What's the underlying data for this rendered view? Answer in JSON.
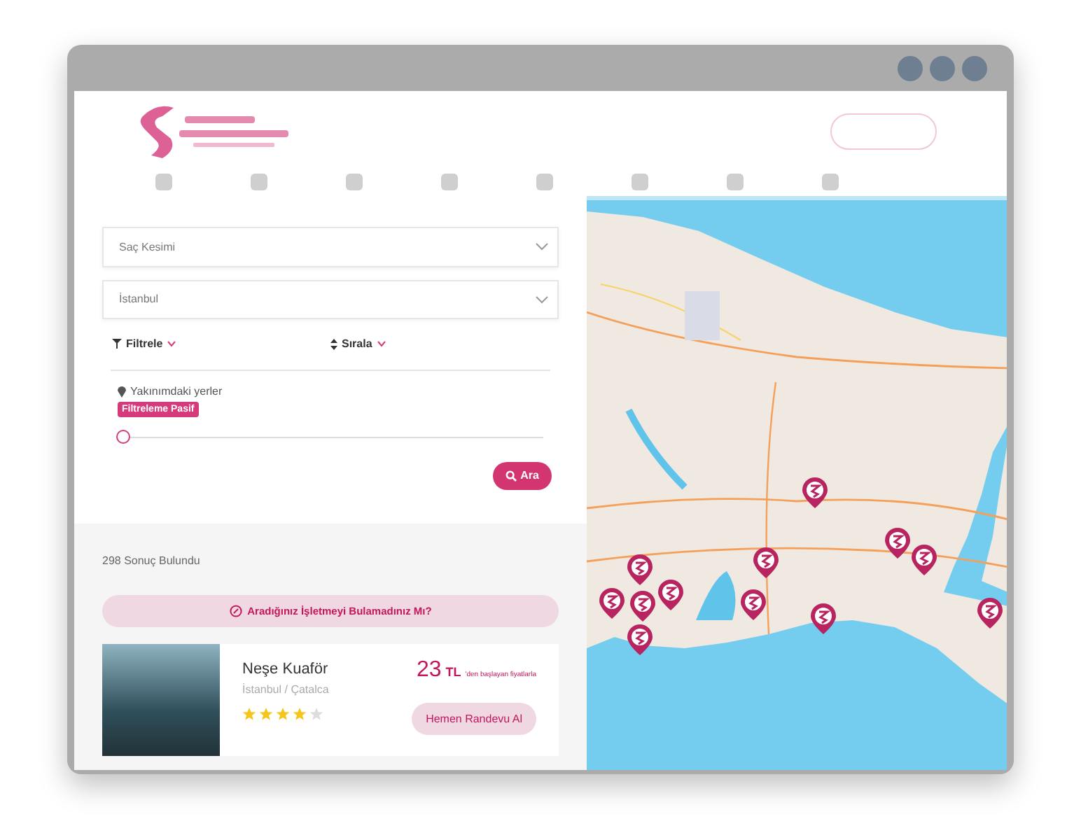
{
  "search": {
    "service": "Saç Kesimi",
    "city": "İstanbul"
  },
  "filter_label": "Filtrele",
  "sort_label": "Sırala",
  "nearby": {
    "label": "Yakınımdaki yerler",
    "badge": "Filtreleme Pasif",
    "level": 0
  },
  "search_button": "Ara",
  "result_count": "298 Sonuç Bulundu",
  "not_found_button": "Aradığınız İşletmeyi Bulamadınız Mı?",
  "results": [
    {
      "name": "Neşe Kuaför",
      "location": "İstanbul / Çatalca",
      "price": "23",
      "currency": "TL",
      "price_note": "'den başlayan fiyatlarla",
      "stars": 4,
      "button": "Hemen Randevu Al"
    }
  ]
}
